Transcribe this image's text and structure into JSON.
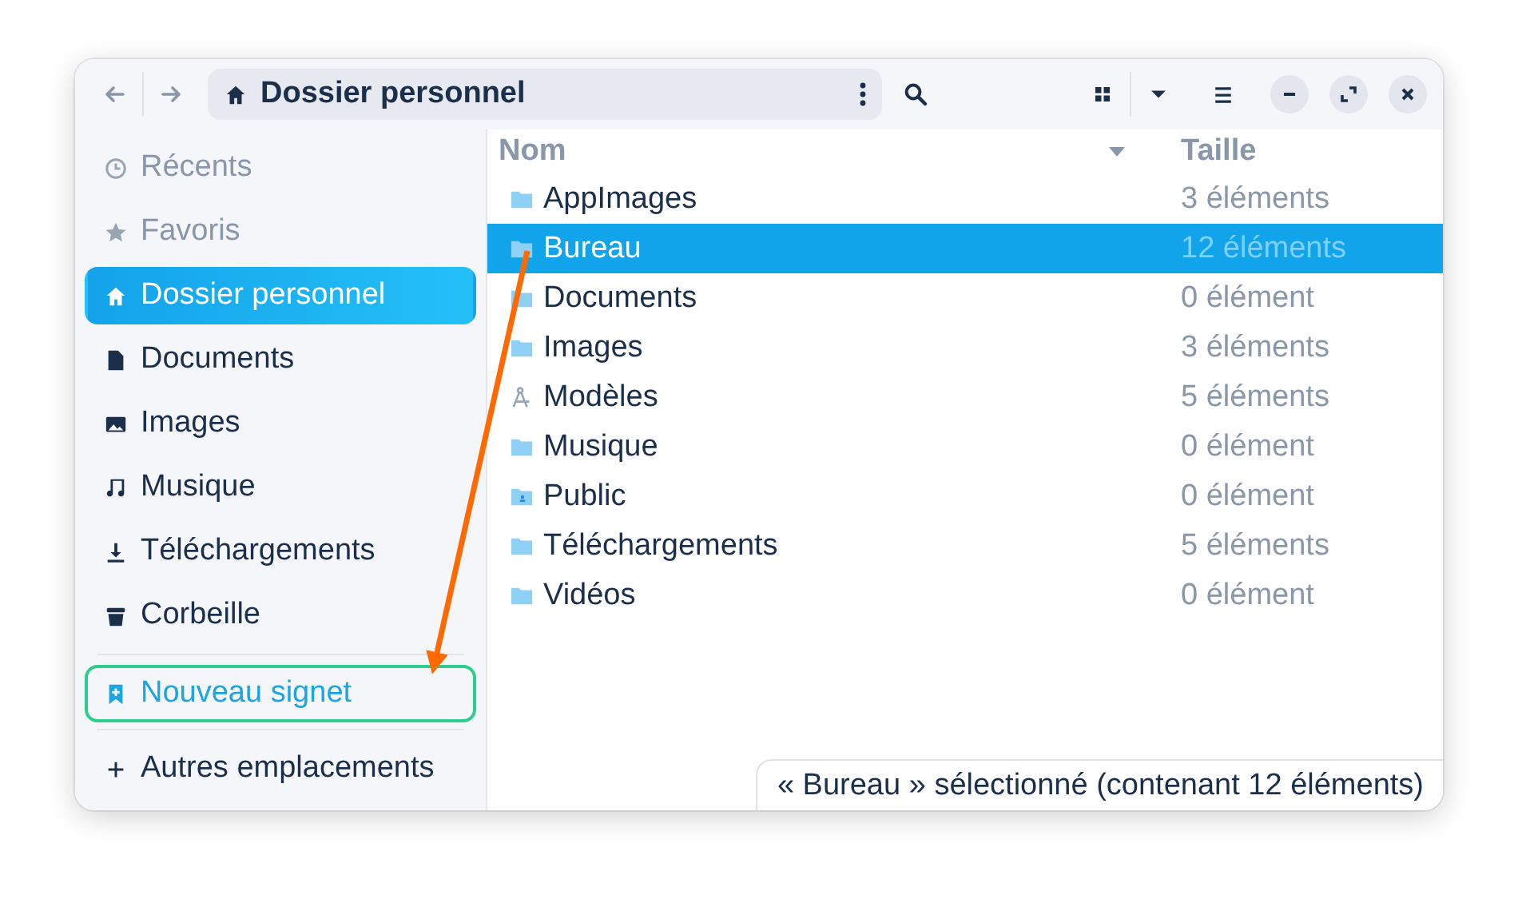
{
  "toolbar": {
    "path": "Dossier personnel"
  },
  "sidebar": {
    "items": [
      {
        "label": "Récents",
        "kind": "recent",
        "selected": false,
        "drop_target": false
      },
      {
        "label": "Favoris",
        "kind": "starred",
        "selected": false,
        "drop_target": false
      },
      {
        "label": "Dossier personnel",
        "kind": "home",
        "selected": true,
        "drop_target": false
      },
      {
        "label": "Documents",
        "kind": "document",
        "selected": false,
        "drop_target": false
      },
      {
        "label": "Images",
        "kind": "image",
        "selected": false,
        "drop_target": false
      },
      {
        "label": "Musique",
        "kind": "music",
        "selected": false,
        "drop_target": false
      },
      {
        "label": "Téléchargements",
        "kind": "download",
        "selected": false,
        "drop_target": false
      },
      {
        "label": "Corbeille",
        "kind": "trash",
        "selected": false,
        "drop_target": false
      }
    ],
    "bookmark": {
      "label": "Nouveau signet",
      "drop_target": true
    },
    "other_locations": {
      "label": "Autres emplacements"
    }
  },
  "table": {
    "columns": [
      "Nom",
      "Taille"
    ],
    "rows": [
      {
        "name": "AppImages",
        "size": "3 éléments",
        "kind": "folder",
        "selected": false
      },
      {
        "name": "Bureau",
        "size": "12 éléments",
        "kind": "folder",
        "selected": true
      },
      {
        "name": "Documents",
        "size": "0 élément",
        "kind": "folder",
        "selected": false
      },
      {
        "name": "Images",
        "size": "3 éléments",
        "kind": "folder",
        "selected": false
      },
      {
        "name": "Modèles",
        "size": "5 éléments",
        "kind": "templates",
        "selected": false
      },
      {
        "name": "Musique",
        "size": "0 élément",
        "kind": "folder",
        "selected": false
      },
      {
        "name": "Public",
        "size": "0 élément",
        "kind": "public",
        "selected": false
      },
      {
        "name": "Téléchargements",
        "size": "5 éléments",
        "kind": "folder",
        "selected": false
      },
      {
        "name": "Vidéos",
        "size": "0 élément",
        "kind": "folder",
        "selected": false
      }
    ]
  },
  "status_bar": "« Bureau » sélectionné (contenant 12 éléments)"
}
